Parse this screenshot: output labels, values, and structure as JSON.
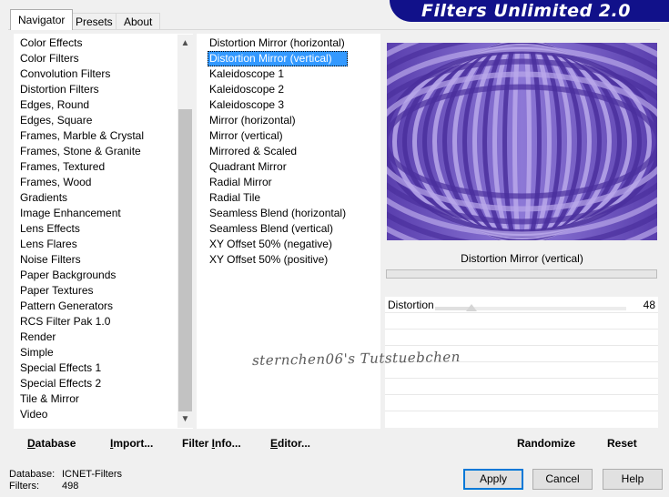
{
  "tabs": [
    {
      "label": "Navigator",
      "active": true
    },
    {
      "label": "Presets",
      "active": false
    },
    {
      "label": "About",
      "active": false
    }
  ],
  "banner": {
    "title": "Filters Unlimited 2.0"
  },
  "categories": [
    "Color Effects",
    "Color Filters",
    "Convolution Filters",
    "Distortion Filters",
    "Edges, Round",
    "Edges, Square",
    "Frames, Marble & Crystal",
    "Frames, Stone & Granite",
    "Frames, Textured",
    "Frames, Wood",
    "Gradients",
    "Image Enhancement",
    "Lens Effects",
    "Lens Flares",
    "Noise Filters",
    "Paper Backgrounds",
    "Paper Textures",
    "Pattern Generators",
    "RCS Filter Pak 1.0",
    "Render",
    "Simple",
    "Special Effects 1",
    "Special Effects 2",
    "Tile & Mirror",
    "Video"
  ],
  "filters": [
    {
      "label": "Distortion Mirror (horizontal)",
      "selected": false
    },
    {
      "label": "Distortion Mirror (vertical)",
      "selected": true
    },
    {
      "label": "Kaleidoscope 1",
      "selected": false
    },
    {
      "label": "Kaleidoscope 2",
      "selected": false
    },
    {
      "label": "Kaleidoscope 3",
      "selected": false
    },
    {
      "label": "Mirror (horizontal)",
      "selected": false
    },
    {
      "label": "Mirror (vertical)",
      "selected": false
    },
    {
      "label": "Mirrored & Scaled",
      "selected": false
    },
    {
      "label": "Quadrant Mirror",
      "selected": false
    },
    {
      "label": "Radial Mirror",
      "selected": false
    },
    {
      "label": "Radial Tile",
      "selected": false
    },
    {
      "label": "Seamless Blend (horizontal)",
      "selected": false
    },
    {
      "label": "Seamless Blend (vertical)",
      "selected": false
    },
    {
      "label": "XY Offset 50% (negative)",
      "selected": false
    },
    {
      "label": "XY Offset 50% (positive)",
      "selected": false
    }
  ],
  "preview": {
    "filter_name": "Distortion Mirror (vertical)",
    "colors": {
      "light": "#b9a8ea",
      "dark": "#4a2f9c"
    }
  },
  "parameters": [
    {
      "label": "Distortion",
      "value": "48",
      "fraction": 0.19
    }
  ],
  "tool_buttons": {
    "database": {
      "label": "Database",
      "accel": "D",
      "rest": "atabase"
    },
    "import": {
      "label": "Import...",
      "accel": "I",
      "rest": "mport..."
    },
    "filter_info": {
      "label": "Filter Info...",
      "pre": "Filter ",
      "accel": "I",
      "rest": "nfo..."
    },
    "editor": {
      "label": "Editor...",
      "accel": "E",
      "rest": "ditor..."
    },
    "randomize": {
      "label": "Randomize"
    },
    "reset": {
      "label": "Reset"
    }
  },
  "status": {
    "database_label": "Database:",
    "database_value": "ICNET-Filters",
    "filters_label": "Filters:",
    "filters_value": "498"
  },
  "dialog_buttons": {
    "apply": "Apply",
    "cancel": "Cancel",
    "help": "Help"
  },
  "watermark": "sternchen06's Tutstuebchen"
}
